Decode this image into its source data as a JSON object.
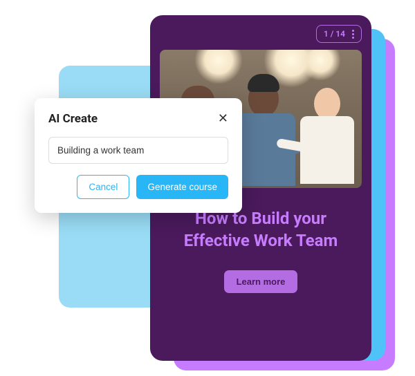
{
  "phone": {
    "page_counter": "1 / 14",
    "course_title": "How to Build your Effective Work Team",
    "learn_more_label": "Learn more"
  },
  "dialog": {
    "title": "AI Create",
    "input_value": "Building a work team",
    "cancel_label": "Cancel",
    "generate_label": "Generate course"
  }
}
